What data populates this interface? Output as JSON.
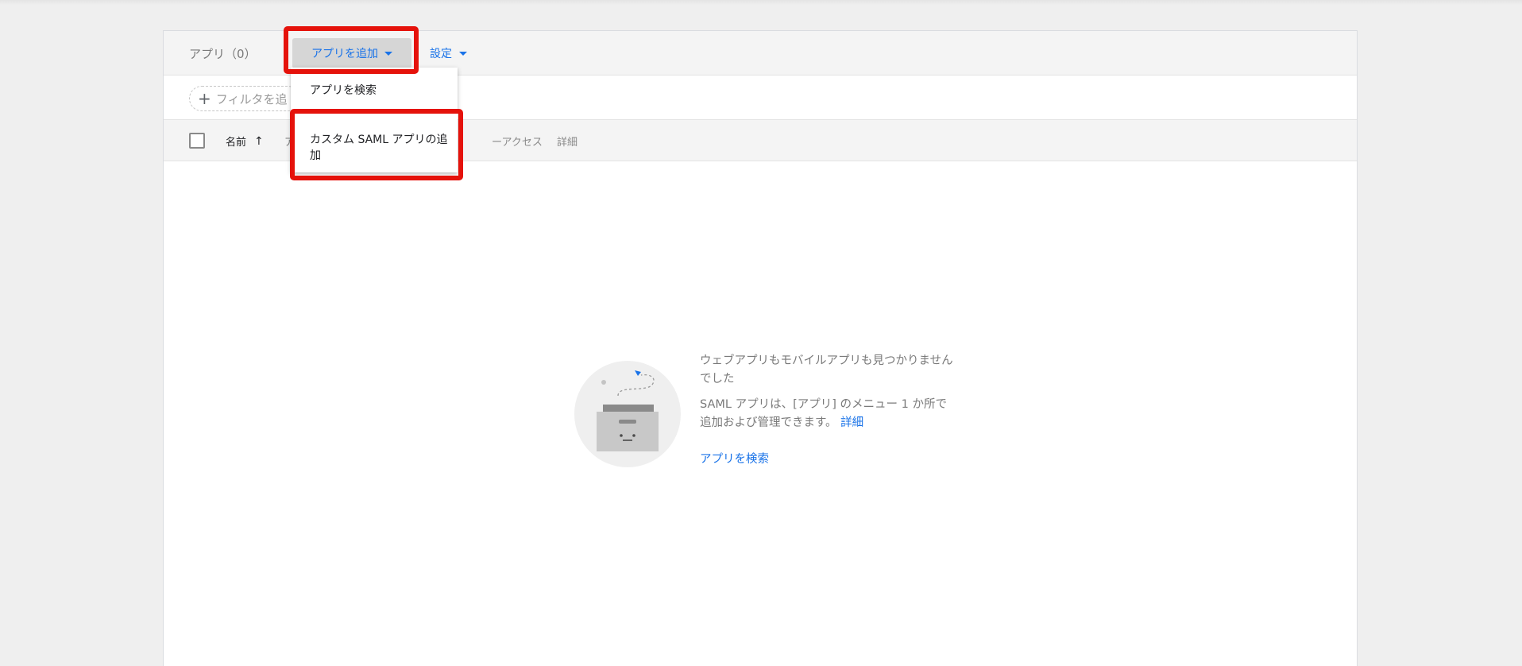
{
  "header": {
    "apps_count": "アプリ（0）",
    "add_app_label": "アプリを追加",
    "settings_label": "設定"
  },
  "filter": {
    "placeholder": "フィルタを追"
  },
  "columns": {
    "name": "名前",
    "partial": "ア",
    "access": "ーアクセス",
    "details": "詳細"
  },
  "dropdown": {
    "items": [
      {
        "label": "アプリを検索"
      },
      {
        "label": "カスタム SAML アプリの追加"
      }
    ]
  },
  "empty_state": {
    "title": "ウェブアプリもモバイルアプリも見つかりませんでした",
    "desc_before": "SAML アプリは、[アプリ] のメニュー 1 か所で追加および管理できます。",
    "desc_link": "詳細",
    "search_link": "アプリを検索"
  },
  "colors": {
    "accent": "#1a73e8",
    "highlight": "#e5120b"
  }
}
